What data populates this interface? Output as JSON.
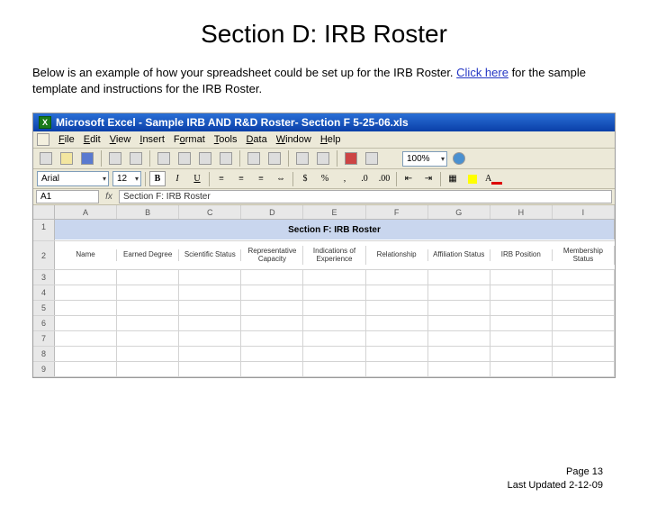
{
  "slide": {
    "title": "Section D: IRB Roster",
    "intro_prefix": "Below is an example of how your spreadsheet could be set up for the IRB Roster. ",
    "link_text": "Click here",
    "intro_suffix": " for the sample template and instructions for the IRB Roster."
  },
  "excel": {
    "window_title": "Microsoft Excel - Sample IRB AND R&D Roster- Section F 5-25-06.xls",
    "menu": [
      "File",
      "Edit",
      "View",
      "Insert",
      "Format",
      "Tools",
      "Data",
      "Window",
      "Help"
    ],
    "font_name": "Arial",
    "font_size": "12",
    "zoom": "100%",
    "namebox": "A1",
    "formula": "Section F:  IRB Roster",
    "columns": [
      "A",
      "B",
      "C",
      "D",
      "E",
      "F",
      "G",
      "H",
      "I"
    ],
    "section_header": "Section F:  IRB Roster",
    "headers": [
      "Name",
      "Earned Degree",
      "Scientific Status",
      "Representative Capacity",
      "Indications of Experience",
      "Relationship",
      "Affiliation Status",
      "IRB Position",
      "Membership Status"
    ],
    "row_numbers": [
      "1",
      "2",
      "3",
      "4",
      "5",
      "6",
      "7",
      "8",
      "9"
    ]
  },
  "footer": {
    "page": "Page 13",
    "updated": "Last Updated 2-12-09"
  }
}
